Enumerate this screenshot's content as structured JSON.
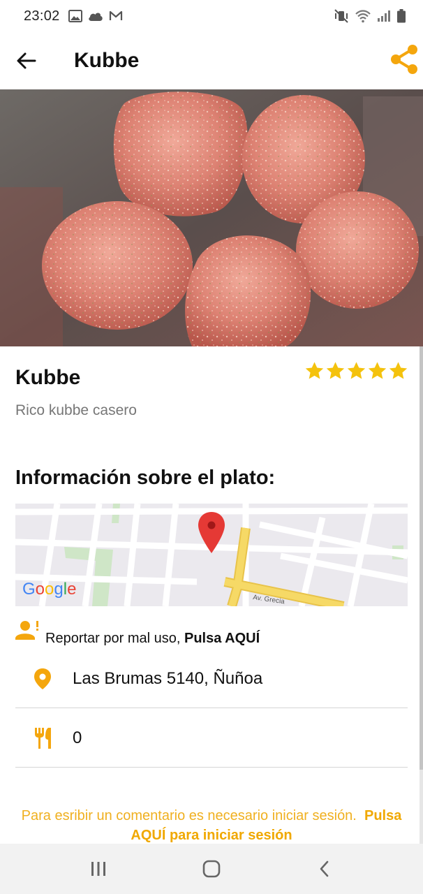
{
  "status_bar": {
    "time": "23:02",
    "left_icons": [
      "gallery-icon",
      "cloud-icon",
      "gmail-icon"
    ],
    "right_icons": [
      "mute-vibrate-icon",
      "wifi-icon",
      "signal-icon",
      "battery-icon"
    ]
  },
  "app_bar": {
    "title": "Kubbe",
    "back_icon": "arrow-left-icon",
    "share_icon": "share-icon"
  },
  "colors": {
    "accent": "#F4A60D",
    "star": "#F4C20D",
    "map_road_major": "#F5D25C"
  },
  "dish": {
    "name": "Kubbe",
    "description": "Rico kubbe casero",
    "rating": 5,
    "rating_max": 5
  },
  "info": {
    "section_title": "Información sobre el plato:",
    "map": {
      "brand": "Google",
      "street_label": "Av. Grecia"
    },
    "report": {
      "text": "Reportar por mal uso, ",
      "link": "Pulsa AQUÍ"
    },
    "address": "Las Brumas 5140, Ñuñoa",
    "servings": "0"
  },
  "comments": {
    "note": "Para esribir un comentario es necesario iniciar sesión.",
    "link": "Pulsa AQUÍ para iniciar sesión"
  }
}
